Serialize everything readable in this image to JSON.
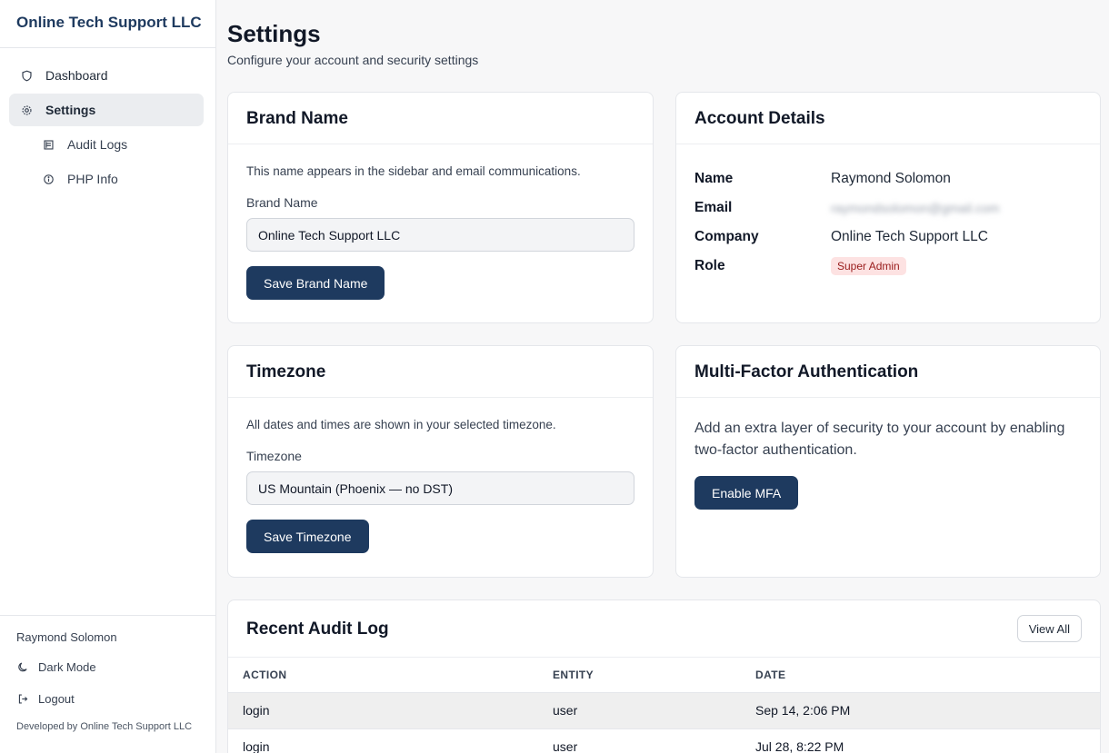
{
  "brand": "Online Tech Support LLC",
  "nav": [
    {
      "label": "Dashboard",
      "icon": "shield-icon",
      "active": false
    },
    {
      "label": "Settings",
      "icon": "gear-icon",
      "active": true
    },
    {
      "label": "Audit Logs",
      "icon": "log-icon",
      "active": false
    },
    {
      "label": "PHP Info",
      "icon": "info-icon",
      "active": false
    }
  ],
  "footer": {
    "user": "Raymond Solomon",
    "dark_mode": "Dark Mode",
    "logout": "Logout",
    "developed_by": "Developed by Online Tech Support LLC"
  },
  "page": {
    "title": "Settings",
    "subtitle": "Configure your account and security settings"
  },
  "brand_card": {
    "title": "Brand Name",
    "description": "This name appears in the sidebar and email communications.",
    "label": "Brand Name",
    "value": "Online Tech Support LLC",
    "button": "Save Brand Name"
  },
  "account": {
    "title": "Account Details",
    "name_label": "Name",
    "name": "Raymond Solomon",
    "email_label": "Email",
    "email": "raymondsolomon@gmail.com",
    "company_label": "Company",
    "company": "Online Tech Support LLC",
    "role_label": "Role",
    "role": "Super Admin"
  },
  "timezone_card": {
    "title": "Timezone",
    "description": "All dates and times are shown in your selected timezone.",
    "label": "Timezone",
    "value": "US Mountain (Phoenix — no DST)",
    "button": "Save Timezone"
  },
  "mfa": {
    "title": "Multi-Factor Authentication",
    "description": "Add an extra layer of security to your account by enabling two-factor authentication.",
    "button": "Enable MFA"
  },
  "audit": {
    "title": "Recent Audit Log",
    "view_all": "View All",
    "columns": [
      "ACTION",
      "ENTITY",
      "DATE"
    ],
    "rows": [
      {
        "action": "login",
        "entity": "user",
        "date": "Sep 14, 2:06 PM"
      },
      {
        "action": "login",
        "entity": "user",
        "date": "Jul 28, 8:22 PM"
      }
    ]
  },
  "colors": {
    "primary": "#1e3a5f",
    "badge_bg": "#fde2e2",
    "badge_text": "#991b1b"
  }
}
